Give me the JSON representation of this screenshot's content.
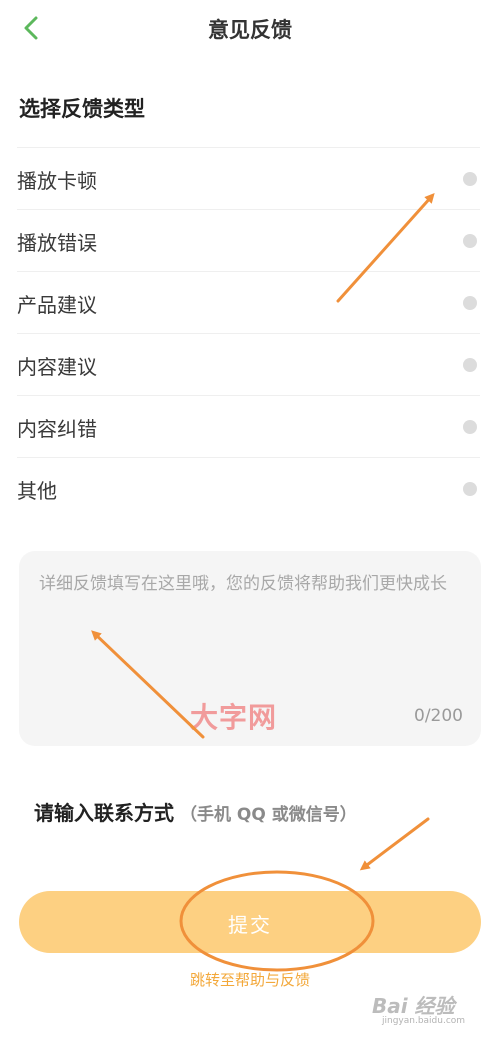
{
  "header": {
    "title": "意见反馈",
    "back_icon": "chevron-left-icon"
  },
  "section": {
    "title": "选择反馈类型"
  },
  "options": [
    {
      "label": "播放卡顿"
    },
    {
      "label": "播放错误"
    },
    {
      "label": "产品建议"
    },
    {
      "label": "内容建议"
    },
    {
      "label": "内容纠错"
    },
    {
      "label": "其他"
    }
  ],
  "feedback": {
    "placeholder": "详细反馈填写在这里哦，您的反馈将帮助我们更快成长",
    "value": "",
    "counter": "0/200"
  },
  "contact": {
    "label": "请输入联系方式",
    "hint": "（手机 QQ 或微信号）"
  },
  "submit": {
    "label": "提交"
  },
  "help_link": {
    "label": "跳转至帮助与反馈"
  },
  "watermarks": {
    "center": "大字网",
    "baidu_logo": "Bai 经验",
    "baidu_url": "jingyan.baidu.com"
  },
  "colors": {
    "accent": "#5cb85c",
    "submit_bg": "#fdd082",
    "link": "#f3a83a",
    "annotation": "#f0903a",
    "watermark": "#ec5050"
  }
}
